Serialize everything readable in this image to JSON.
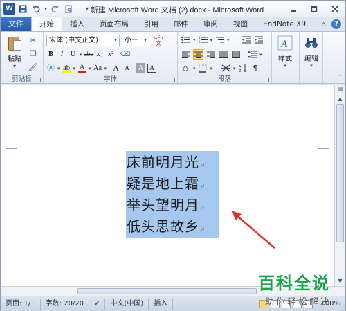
{
  "window": {
    "title": "新建 Microsoft Word 文档 (2).docx - Microsoft Word",
    "app_icon_letter": "W"
  },
  "ribbon_tabs": {
    "file": "文件",
    "items": [
      "开始",
      "插入",
      "页面布局",
      "引用",
      "邮件",
      "审阅",
      "视图",
      "EndNote X9"
    ],
    "active": "开始"
  },
  "clipboard": {
    "paste_label": "粘贴",
    "group_label": "剪贴板"
  },
  "font": {
    "font_name": "宋体 (中文正文)",
    "font_size": "小一",
    "group_label": "字体",
    "wen_label": "wén 文",
    "bold": "B",
    "italic": "I",
    "underline": "U",
    "strike": "abc",
    "subscript": "x₂",
    "superscript": "x²",
    "change_case": "Aa",
    "grow": "A",
    "shrink": "A",
    "clear": "A",
    "char_border": "A"
  },
  "paragraph": {
    "group_label": "段落",
    "active_alignment": "center"
  },
  "styles": {
    "label": "样式"
  },
  "editing": {
    "label": "编辑"
  },
  "document": {
    "lines": [
      "床前明月光",
      "疑是地上霜",
      "举头望明月",
      "低头思故乡"
    ],
    "paragraph_mark": "↵"
  },
  "status": {
    "page": "页面: 1/1",
    "words": "字数: 20/20",
    "language": "中文(中国)",
    "mode": "插入",
    "zoom": "100%"
  },
  "watermark": {
    "title": "百科全说",
    "subtitle": "助你轻松解决"
  },
  "colors": {
    "accent": "#2b579a",
    "selection": "#a6c8ef",
    "annotation_arrow": "#d9302c",
    "watermark_green": "#1aa34a"
  }
}
